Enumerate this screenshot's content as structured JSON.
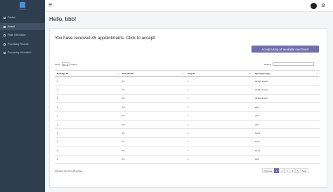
{
  "sidebar": {
    "logo_text": "VDOSC001",
    "items": [
      {
        "label": "Publish"
      },
      {
        "label": "Accept"
      },
      {
        "label": "Flash Information"
      },
      {
        "label": "Processing Records"
      },
      {
        "label": "Processing Information"
      }
    ]
  },
  "topbar": {
    "menu_icon": "hamburger-icon",
    "settings_icon": "gear-icon"
  },
  "greeting": "Hello, bbb!",
  "received_text": "You have received 45 appointments. Click to accept!",
  "accept_all_label": "Accept using all available machines!",
  "length_menu": {
    "before": "Show",
    "value": "10",
    "after": "entries"
  },
  "search": {
    "label": "Search:",
    "value": ""
  },
  "table": {
    "headers": [
      "Package ID",
      "Chip Model",
      "Chip ID",
      "Operation Type"
    ],
    "rows": [
      [
        "2",
        "15",
        "1",
        "design-import"
      ],
      [
        "2",
        "17",
        "1",
        "design-import"
      ],
      [
        "2",
        "18",
        "1",
        "design-import"
      ],
      [
        "2",
        "15",
        "1",
        "etch"
      ],
      [
        "2",
        "17",
        "1",
        "etch"
      ],
      [
        "2",
        "18",
        "1",
        "etch"
      ],
      [
        "2",
        "15",
        "1",
        "bond"
      ],
      [
        "2",
        "17",
        "1",
        "bond"
      ],
      [
        "2",
        "18",
        "1",
        "bond"
      ],
      [
        "2",
        "15",
        "1",
        "split"
      ]
    ]
  },
  "info_text": "Showing 1 to 10 of 45 entries",
  "pagination": {
    "previous": "Previous",
    "pages": [
      "1",
      "2",
      "3",
      "4",
      "5"
    ],
    "current": "1",
    "next": "Next"
  },
  "colors": {
    "sidebar": "#2f3e4e",
    "accent": "#6f6fae",
    "background": "#f4f5f7"
  }
}
